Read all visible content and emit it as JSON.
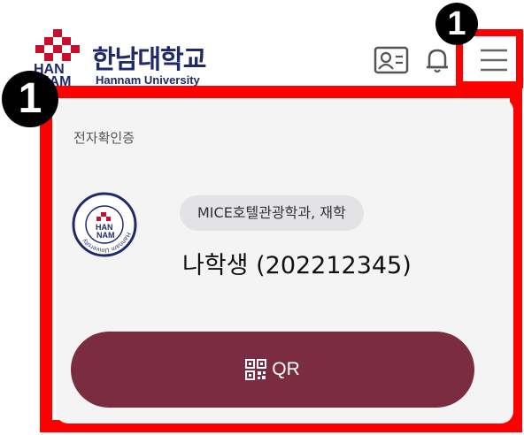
{
  "header": {
    "logo_korean": "한남대학교",
    "logo_english": "Hannam University",
    "logo_mark_text": [
      "HAN",
      "NAM"
    ]
  },
  "markers": {
    "top_label": "1",
    "left_label": "1"
  },
  "card": {
    "title": "전자확인증",
    "emblem_text": "Hannam University",
    "department_status": "MICE호텔관광학과, 재학",
    "student_name": "나학생 (202212345)",
    "qr_label": "QR"
  },
  "colors": {
    "brand_navy": "#1f2a6b",
    "brand_red": "#c8102e",
    "qr_button": "#7b2c40",
    "annotation_red": "#ff0000",
    "card_bg": "#f4f4f4"
  },
  "icons": {
    "id_card": "id-card-icon",
    "bell": "bell-icon",
    "menu": "hamburger-menu-icon",
    "qr": "qr-code-icon"
  }
}
